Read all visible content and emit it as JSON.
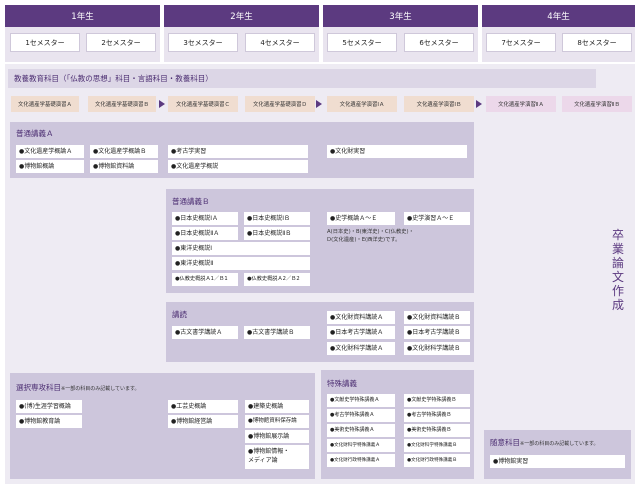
{
  "years": [
    "1年生",
    "2年生",
    "3年生",
    "4年生"
  ],
  "semesters": [
    "1セメスター",
    "2セメスター",
    "3セメスター",
    "4セメスター",
    "5セメスター",
    "6セメスター",
    "7セメスター",
    "8セメスター"
  ],
  "liberal": {
    "title": "教養教育科目（「仏教の思想」科目・言語科目・教養科目）"
  },
  "seminars": [
    "文化遺産学基礎演習Ａ",
    "文化遺産学基礎演習Ｂ",
    "文化遺産学基礎演習Ｃ",
    "文化遺産学基礎演習Ｄ",
    "文化遺産学演習ⅠＡ",
    "文化遺産学演習ⅠＢ",
    "文化遺産学演習ⅡＡ",
    "文化遺産学演習ⅡＢ"
  ],
  "generalA": {
    "title": "普通講義Ａ",
    "items": [
      "●文化遺産学概論Ａ",
      "●文化遺産学概論Ｂ",
      "●博物館概論",
      "●博物館資料論",
      "●考古学実習",
      "●文化遺産学概説",
      "●文化財実習"
    ]
  },
  "generalB": {
    "title": "普通講義Ｂ",
    "items": [
      "●日本史概説ⅠＡ",
      "●日本史概説ⅠＢ",
      "●日本史概説ⅡＡ",
      "●日本史概説ⅡＢ",
      "●東洋史概説Ⅰ",
      "●東洋史概説Ⅱ",
      "●仏教史概説Ａ1／Ｂ1",
      "●仏教史概説Ａ2／Ｂ2",
      "●史学概論Ａ～Ｅ",
      "●史学演習Ａ～Ｅ"
    ],
    "note": "A(日本史)・B(東洋史)・C(仏教史)・\nD(文化遺産)・E(西洋史)です。"
  },
  "reading": {
    "title": "講読",
    "items": [
      "●古文書学講読Ａ",
      "●古文書学講読Ｂ",
      "●文化財資料講読Ａ",
      "●文化財資料講読Ｂ",
      "●日本考古学講読Ａ",
      "●日本考古学講読Ｂ",
      "●文化財科学講読Ａ",
      "●文化財科学講読Ｂ"
    ]
  },
  "elective": {
    "title": "選択専攻科目",
    "note": "※一部の科目のみ記載しています。",
    "items": [
      "●(博)生涯学習概論",
      "●博物館教育論",
      "●工芸史概論",
      "●博物館経営論",
      "●建築史概論",
      "●博物館資料保存論",
      "●博物館展示論",
      "●博物館情報・\nメディア論"
    ]
  },
  "special": {
    "title": "特殊講義",
    "items": [
      "●文献史学特殊講義Ａ",
      "●文献史学特殊講義Ｂ",
      "●考古学特殊講義Ａ",
      "●考古学特殊講義Ｂ",
      "●美術史特殊講義Ａ",
      "●美術史特殊講義Ｂ",
      "●文化財科学特殊講義Ａ",
      "●文化財科学特殊講義Ｂ",
      "●文化財行政特殊講義Ａ",
      "●文化財行政特殊講義Ｂ"
    ]
  },
  "free": {
    "title": "随意科目",
    "note": "※一部の科目のみ記載しています。",
    "items": [
      "●博物館実習"
    ]
  },
  "thesis": "卒\n業\n論\n文\n作\n成",
  "colors": {
    "header": "#5c3a80",
    "band": "#dcd6e6",
    "box": "#cdc6dc"
  }
}
